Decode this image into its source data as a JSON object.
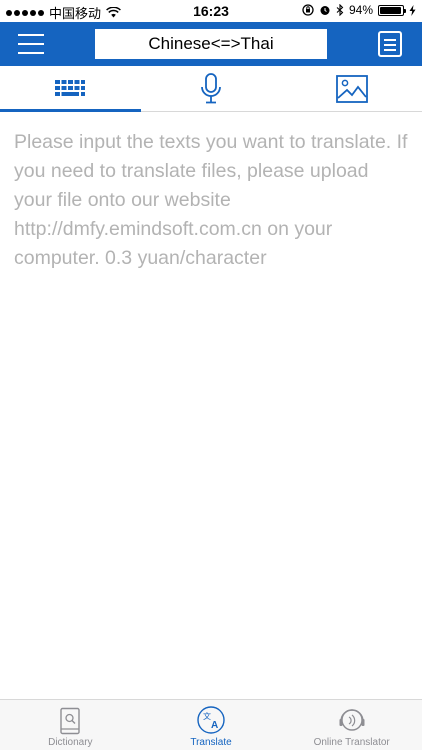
{
  "status_bar": {
    "carrier": "中国移动",
    "time": "16:23",
    "battery_percent": "94%",
    "battery_level": 0.94,
    "icons": [
      "signal-dots-icon",
      "wifi-icon",
      "lock-rotation-icon",
      "alarm-icon",
      "bluetooth-icon",
      "battery-icon",
      "charging-bolt-icon"
    ]
  },
  "nav": {
    "title": "Chinese<=>Thai",
    "left_icon": "menu-icon",
    "right_icon": "document-icon",
    "color": "#1564c0"
  },
  "tabs": [
    {
      "icon": "keyboard-icon",
      "active": true
    },
    {
      "icon": "microphone-icon",
      "active": false
    },
    {
      "icon": "image-icon",
      "active": false
    }
  ],
  "input": {
    "placeholder": "Please input the texts you want to translate. If you need to translate files, please upload your file onto our website http://dmfy.emindsoft.com.cn on your computer. 0.3 yuan/character",
    "value": ""
  },
  "bottom_tabs": [
    {
      "label": "Dictionary",
      "icon": "dictionary-icon",
      "active": false
    },
    {
      "label": "Translate",
      "icon": "translate-icon",
      "active": true
    },
    {
      "label": "Online Translator",
      "icon": "online-translator-icon",
      "active": false
    }
  ]
}
